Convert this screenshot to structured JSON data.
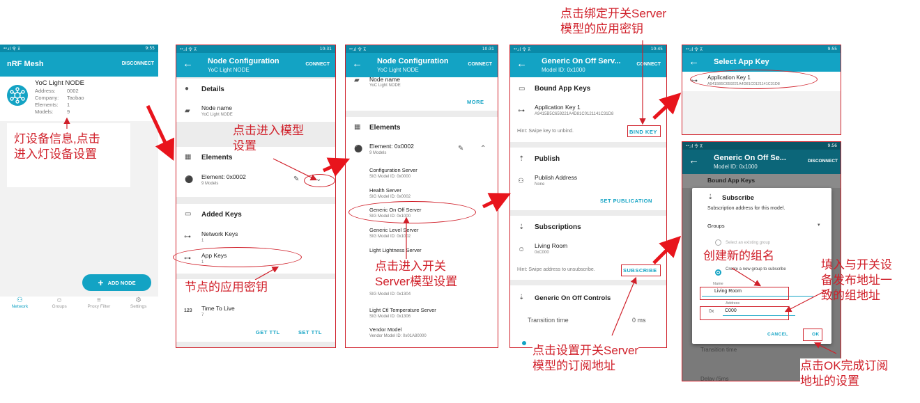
{
  "colors": {
    "accent": "#13a3c4",
    "statusbar": "#0a8aa8",
    "annotation": "#d0202a"
  },
  "status": {
    "signal": "ᵊᵊ.ıl 令 ⊼",
    "time1": "9:55",
    "time2": "10:31",
    "time3": "10:45"
  },
  "s1": {
    "title": "nRF Mesh",
    "action": "DISCONNECT",
    "node_name": "YoC Light NODE",
    "rows": [
      {
        "k": "Address:",
        "v": "0002"
      },
      {
        "k": "Company:",
        "v": "Taobao"
      },
      {
        "k": "Elements:",
        "v": "1"
      },
      {
        "k": "Models:",
        "v": "9"
      }
    ],
    "fab": "ADD NODE",
    "nav": [
      {
        "icon": "network-icon",
        "label": "Network"
      },
      {
        "icon": "groups-icon",
        "label": "Groups"
      },
      {
        "icon": "proxy-filter-icon",
        "label": "Proxy Filter"
      },
      {
        "icon": "settings-icon",
        "label": "Settings"
      }
    ]
  },
  "s2": {
    "title": "Node Configuration",
    "subtitle": "YoC Light NODE",
    "action": "CONNECT",
    "details": "Details",
    "node_name_label": "Node name",
    "node_name": "YoC Light NODE",
    "elements": "Elements",
    "element": "Element: 0x0002",
    "element_models": "9 Models",
    "added_keys": "Added Keys",
    "network_keys": "Network Keys",
    "network_keys_count": "1",
    "app_keys": "App Keys",
    "app_keys_count": "1",
    "ttl": "Time To Live",
    "ttl_value": "7",
    "get_ttl": "GET TTL",
    "set_ttl": "SET TTL"
  },
  "s3": {
    "title": "Node Configuration",
    "subtitle": "YoC Light NODE",
    "action": "CONNECT",
    "node_name_label": "Node name",
    "node_name": "YoC Light NODE",
    "more": "MORE",
    "elements": "Elements",
    "element": "Element: 0x0002",
    "element_models": "9 Models",
    "models": [
      {
        "name": "Configuration Server",
        "id": "SIG Model ID: 0x0000"
      },
      {
        "name": "Health Server",
        "id": "SIG Model ID: 0x0002"
      },
      {
        "name": "Generic On Off Server",
        "id": "SIG Model ID: 0x1000"
      },
      {
        "name": "Generic Level Server",
        "id": "SIG Model ID: 0x1002"
      },
      {
        "name": "Light Lightness Server",
        "id": ""
      },
      {
        "name": "",
        "id": "SIG Model ID: 0x1304"
      },
      {
        "name": "Light Ctl Temperature Server",
        "id": "SIG Model ID: 0x1306"
      },
      {
        "name": "Vendor Model",
        "id": "Vendor Model ID: 0x01A80000"
      }
    ]
  },
  "s4": {
    "title": "Generic On Off Serv...",
    "subtitle": "Model ID: 0x1000",
    "action": "CONNECT",
    "bound": "Bound App Keys",
    "app_key": "Application Key 1",
    "app_key_hex": "A9415B5C659221A4D81C0121141C31D8",
    "hint1": "Hint: Swipe key to unbind.",
    "bind_key": "BIND KEY",
    "publish": "Publish",
    "pub_addr": "Publish Address",
    "pub_none": "None",
    "set_pub": "SET PUBLICATION",
    "subs": "Subscriptions",
    "living_room": "Living Room",
    "living_addr": "0xC000",
    "hint2": "Hint: Swipe address to unsubscribe.",
    "subscribe": "SUBSCRIBE",
    "controls": "Generic On Off Controls",
    "transition": "Transition time",
    "transition_val": "0 ms"
  },
  "s5": {
    "title": "Select App Key",
    "key": "Application Key 1",
    "key_hex": "A9415B5C659221A4D81C0121141C31D8",
    "time": "9:55"
  },
  "s6": {
    "title": "Generic On Off Se...",
    "subtitle": "Model ID: 0x1000",
    "action": "DISCONNECT",
    "time": "9:56",
    "bound": "Bound App Keys",
    "dlg_title": "Subscribe",
    "dlg_desc": "Subscription address for this model.",
    "groups": "Groups",
    "opt_existing": "Select an existing group",
    "opt_new": "Create a new group to subscribe",
    "name_label": "Name",
    "name_val": "Living Room",
    "addr_label": "Address",
    "addr_prefix": "0x",
    "addr_val": "C000",
    "cancel": "CANCEL",
    "ok": "OK",
    "transition": "Transition time",
    "delay": "Delay (5ms"
  },
  "ann": {
    "a1": "灯设备信息,点击\n进入灯设备设置",
    "a2": "点击进入模型\n设置",
    "a3": "节点的应用密钥",
    "a4": "点击进入开关\nServer模型设置",
    "a5": "点击绑定开关Server\n模型的应用密钥",
    "a6": "点击设置开关Server\n模型的订阅地址",
    "a7": "创建新的组名",
    "a8": "填入与开关设\n备发布地址一\n致的组地址",
    "a9": "点击OK完成订阅\n地址的设置"
  }
}
